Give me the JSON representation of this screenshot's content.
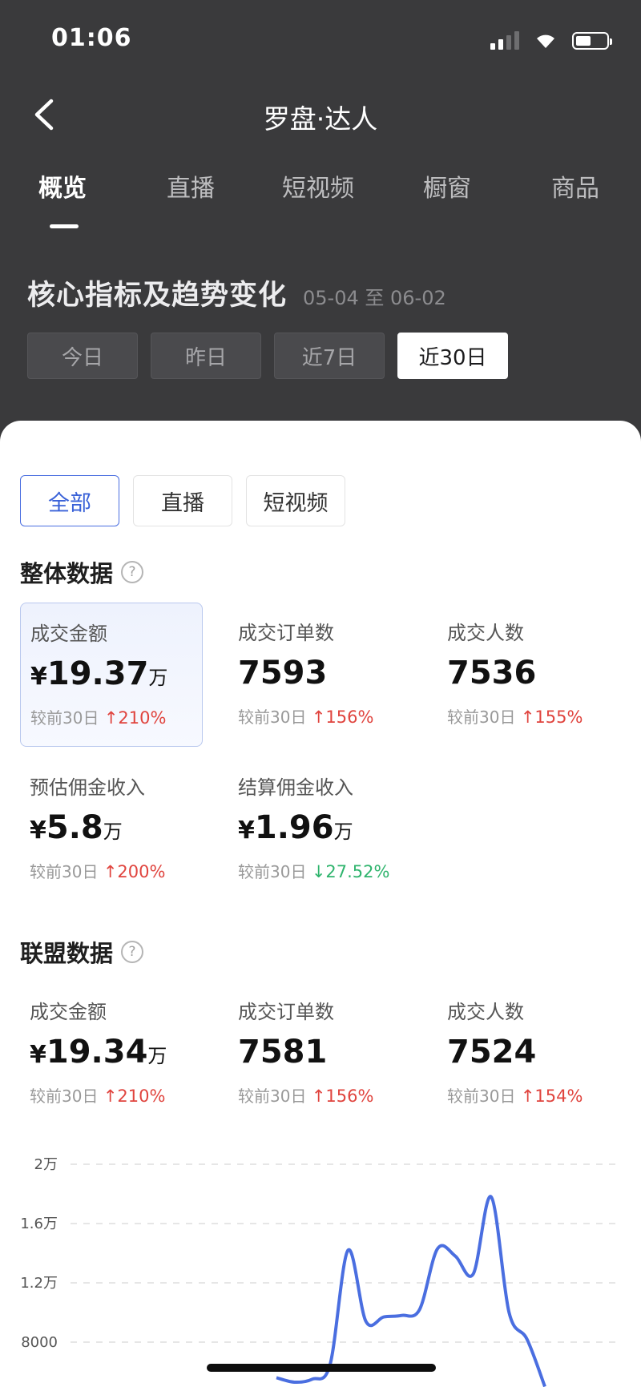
{
  "status": {
    "time": "01:06"
  },
  "nav": {
    "title": "罗盘·达人"
  },
  "tabs": [
    "概览",
    "直播",
    "短视频",
    "橱窗",
    "商品"
  ],
  "core": {
    "title": "核心指标及趋势变化",
    "date_range": "05-04 至 06-02",
    "ranges": [
      "今日",
      "昨日",
      "近7日",
      "近30日"
    ]
  },
  "types": [
    "全部",
    "直播",
    "短视频"
  ],
  "overall": {
    "title": "整体数据",
    "help": "?",
    "compare_label": "较前30日",
    "metrics": [
      {
        "label": "成交金额",
        "currency": "¥",
        "value": "19.37",
        "unit": "万",
        "change": "↑210%",
        "direction": "up"
      },
      {
        "label": "成交订单数",
        "currency": "",
        "value": "7593",
        "unit": "",
        "change": "↑156%",
        "direction": "up"
      },
      {
        "label": "成交人数",
        "currency": "",
        "value": "7536",
        "unit": "",
        "change": "↑155%",
        "direction": "up"
      },
      {
        "label": "预估佣金收入",
        "currency": "¥",
        "value": "5.8",
        "unit": "万",
        "change": "↑200%",
        "direction": "up"
      },
      {
        "label": "结算佣金收入",
        "currency": "¥",
        "value": "1.96",
        "unit": "万",
        "change": "↓27.52%",
        "direction": "down"
      }
    ]
  },
  "league": {
    "title": "联盟数据",
    "help": "?",
    "compare_label": "较前30日",
    "metrics": [
      {
        "label": "成交金额",
        "currency": "¥",
        "value": "19.34",
        "unit": "万",
        "change": "↑210%",
        "direction": "up"
      },
      {
        "label": "成交订单数",
        "currency": "",
        "value": "7581",
        "unit": "",
        "change": "↑156%",
        "direction": "up"
      },
      {
        "label": "成交人数",
        "currency": "",
        "value": "7524",
        "unit": "",
        "change": "↑154%",
        "direction": "up"
      }
    ]
  },
  "chart_data": {
    "type": "line",
    "series": [
      {
        "values": [
          5600,
          5300,
          5500,
          6500,
          14200,
          9400,
          9700,
          9800,
          10200,
          14300,
          13800,
          12600,
          17800,
          10000,
          8200,
          5000
        ]
      }
    ],
    "y_ticks": [
      "2万",
      "1.6万",
      "1.2万",
      "8000"
    ],
    "ylim": [
      5600,
      20000
    ],
    "grid": true,
    "color": "#4a6ee0"
  },
  "colors": {
    "accent": "#4a6ee0",
    "up": "#e0443e",
    "down": "#2fb46d"
  }
}
